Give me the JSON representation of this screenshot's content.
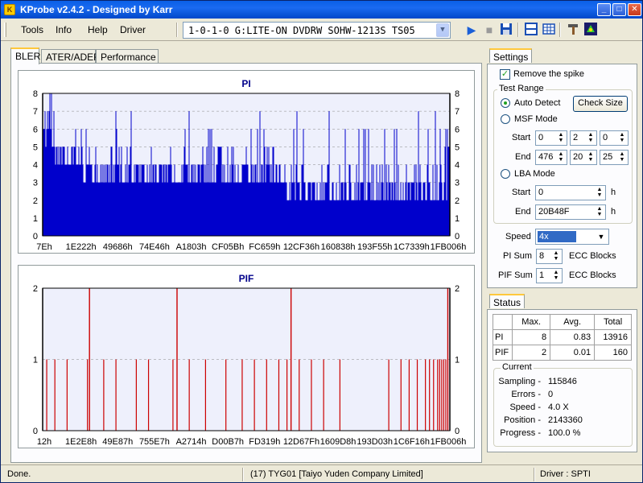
{
  "window": {
    "title": "KProbe v2.4.2 - Designed by Karr"
  },
  "titlebar_buttons": {
    "minimize": "_",
    "maximize": "□",
    "close": "✕"
  },
  "menu": [
    {
      "label": "Tools",
      "key": "T"
    },
    {
      "label": "Info",
      "key": "I"
    },
    {
      "label": "Help",
      "key": "H"
    },
    {
      "label": "Driver",
      "key": "D"
    }
  ],
  "drive": {
    "selected": "1-0-1-0 G:LITE-ON DVDRW SOHW-1213S TS05"
  },
  "toolbar_icons": [
    "play-icon",
    "stop-icon",
    "save-icon",
    "layout-icon",
    "grid-icon",
    "tools-icon",
    "kprobe-icon"
  ],
  "tabs": [
    "BLER",
    "ATER/ADER",
    "Performance"
  ],
  "active_tab": "BLER",
  "charts": [
    {
      "title": "PI",
      "color": "#0000cc",
      "yticks": [
        "0",
        "1",
        "2",
        "3",
        "4",
        "5",
        "6",
        "7",
        "8"
      ],
      "xticks": [
        "7Eh",
        "1E222h",
        "49686h",
        "74E46h",
        "A1803h",
        "CF05Bh",
        "FC659h",
        "12CF36h",
        "160838h",
        "193F55h",
        "1C7339h",
        "1FB006h"
      ]
    },
    {
      "title": "PIF",
      "color": "#cc0000",
      "yticks": [
        "0",
        "1",
        "2"
      ],
      "xticks": [
        "12h",
        "1E2E8h",
        "49E87h",
        "755E7h",
        "A2714h",
        "D00B7h",
        "FD319h",
        "12D67Fh",
        "1609D8h",
        "193D03h",
        "1C6F16h",
        "1FB006h"
      ]
    }
  ],
  "chart_data": [
    {
      "type": "bar",
      "title": "PI",
      "xlabel": "",
      "ylabel": "",
      "ylim": [
        0,
        8
      ],
      "x_range": [
        "7Eh",
        "20B48Fh"
      ],
      "summary": {
        "max": 8,
        "avg": 0.83,
        "total": 13916
      },
      "grid": true
    },
    {
      "type": "bar",
      "title": "PIF",
      "xlabel": "",
      "ylabel": "",
      "ylim": [
        0,
        2
      ],
      "x_range": [
        "12h",
        "20B48Fh"
      ],
      "summary": {
        "max": 2,
        "avg": 0.01,
        "total": 160
      },
      "grid": true
    }
  ],
  "settings": {
    "tab": "Settings",
    "remove_spike": "Remove the spike",
    "test_range": "Test Range",
    "auto_detect": "Auto Detect",
    "check_size": "Check Size",
    "msf_mode": "MSF Mode",
    "start_label": "Start",
    "end_label": "End",
    "msf_start": [
      "0",
      "2",
      "0"
    ],
    "msf_end": [
      "476",
      "20",
      "25"
    ],
    "lba_mode": "LBA Mode",
    "lba_start": "0",
    "lba_end": "20B48F",
    "h": "h",
    "speed_label": "Speed",
    "speed_value": "4x",
    "pi_sum_label": "PI Sum",
    "pi_sum_value": "8",
    "pif_sum_label": "PIF Sum",
    "pif_sum_value": "1",
    "ecc_blocks": "ECC Blocks"
  },
  "status": {
    "tab": "Status",
    "headers": [
      "",
      "Max.",
      "Avg.",
      "Total"
    ],
    "rows": [
      [
        "PI",
        "8",
        "0.83",
        "13916"
      ],
      [
        "PIF",
        "2",
        "0.01",
        "160"
      ]
    ],
    "current_label": "Current",
    "current": [
      {
        "label": "Sampling -",
        "value": "115846"
      },
      {
        "label": "Errors -",
        "value": "0"
      },
      {
        "label": "Speed -",
        "value": "4.0  X"
      },
      {
        "label": "Position -",
        "value": "2143360"
      },
      {
        "label": "Progress -",
        "value": "100.0 %"
      }
    ]
  },
  "statusbar": {
    "left": "Done.",
    "middle": "(17) TYG01 [Taiyo Yuden Company Limited]",
    "right": "Driver : SPTI"
  }
}
